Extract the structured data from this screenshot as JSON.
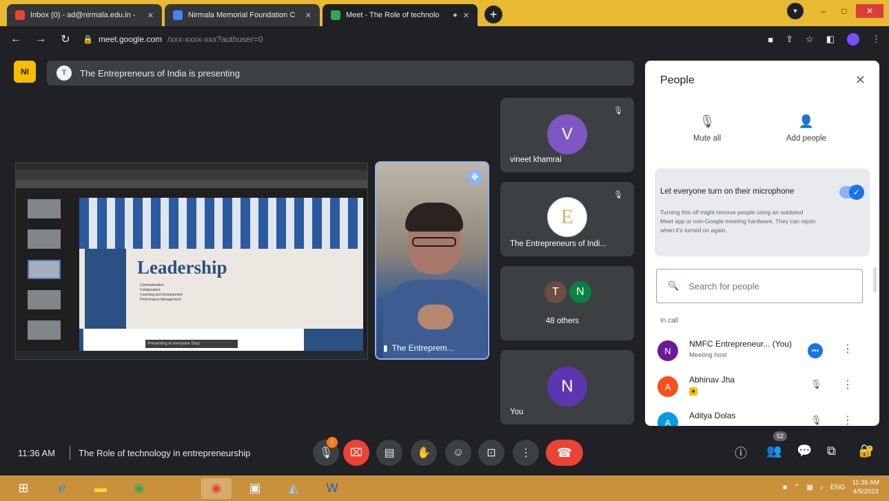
{
  "browser": {
    "tabs": [
      {
        "title": "Inbox (0) - ad@nirmala.edu.in - ",
        "active": false,
        "color": "#ea4335"
      },
      {
        "title": "Nirmala Memorial Foundation C",
        "active": false,
        "color": "#4285f4"
      },
      {
        "title": "Meet - The Role of technolo",
        "active": true,
        "color": "#34a853"
      }
    ],
    "new_tab_label": "+",
    "window_min": "–",
    "window_max": "□",
    "window_close": "✕",
    "url_domain": "meet.google.com",
    "url_path": "/xxx-xxxx-xxx?authuser=0"
  },
  "meet": {
    "logo_text": "NI",
    "presenting_text": "The Entrepreneurs of India is presenting",
    "presenting_icon": "T",
    "slide": {
      "title": "Leadership",
      "bullets": [
        "Communication",
        "Collaboration",
        "Coaching and Development",
        "Performance Management"
      ],
      "caption": "Presenting to everyone   Stop"
    },
    "presenter_name": "The Entreprem..."
  },
  "tiles": [
    {
      "initial": "V",
      "name": "vineet khamrai",
      "color": "#7e57c2"
    },
    {
      "initial": "E",
      "name": "The Entrepreneurs of Indi...",
      "color": "#ffffff"
    },
    {
      "initials": [
        "T",
        "N"
      ],
      "name": "48 others",
      "colors": [
        "#6d4c41",
        "#0b8043"
      ]
    },
    {
      "initial": "N",
      "name": "You",
      "color": "#5e35b1"
    }
  ],
  "people_panel": {
    "title": "People",
    "close": "✕",
    "mute_all": "Mute all",
    "add_people": "Add people",
    "mic_toggle_label": "Let everyone turn on their microphone",
    "mic_toggle_desc": "Turning this off might remove people using an outdated Meet app or non-Google meeting hardware. They can rejoin when it's turned on again.",
    "mic_toggle_on": true,
    "search_placeholder": "Search for people",
    "section_label": "In call",
    "participants": [
      {
        "initial": "N",
        "name": "NMFC Entrepreneur... (You)",
        "sub": "Meeting host",
        "color": "#6a1b9a"
      },
      {
        "initial": "A",
        "name": "Abhinav Jha",
        "sub": "",
        "color": "#f4511e"
      },
      {
        "initial": "A",
        "name": "Aditya Dolas",
        "sub": "",
        "color": "#039be5"
      }
    ]
  },
  "controls": {
    "time": "11:36 AM",
    "meeting_name": "The Role of technology in entrepreneurship",
    "notification_count": "!",
    "participant_count": "52"
  },
  "taskbar": {
    "clock_time": "11:36 AM",
    "clock_date": "4/5/2023",
    "lang": "ENG"
  }
}
